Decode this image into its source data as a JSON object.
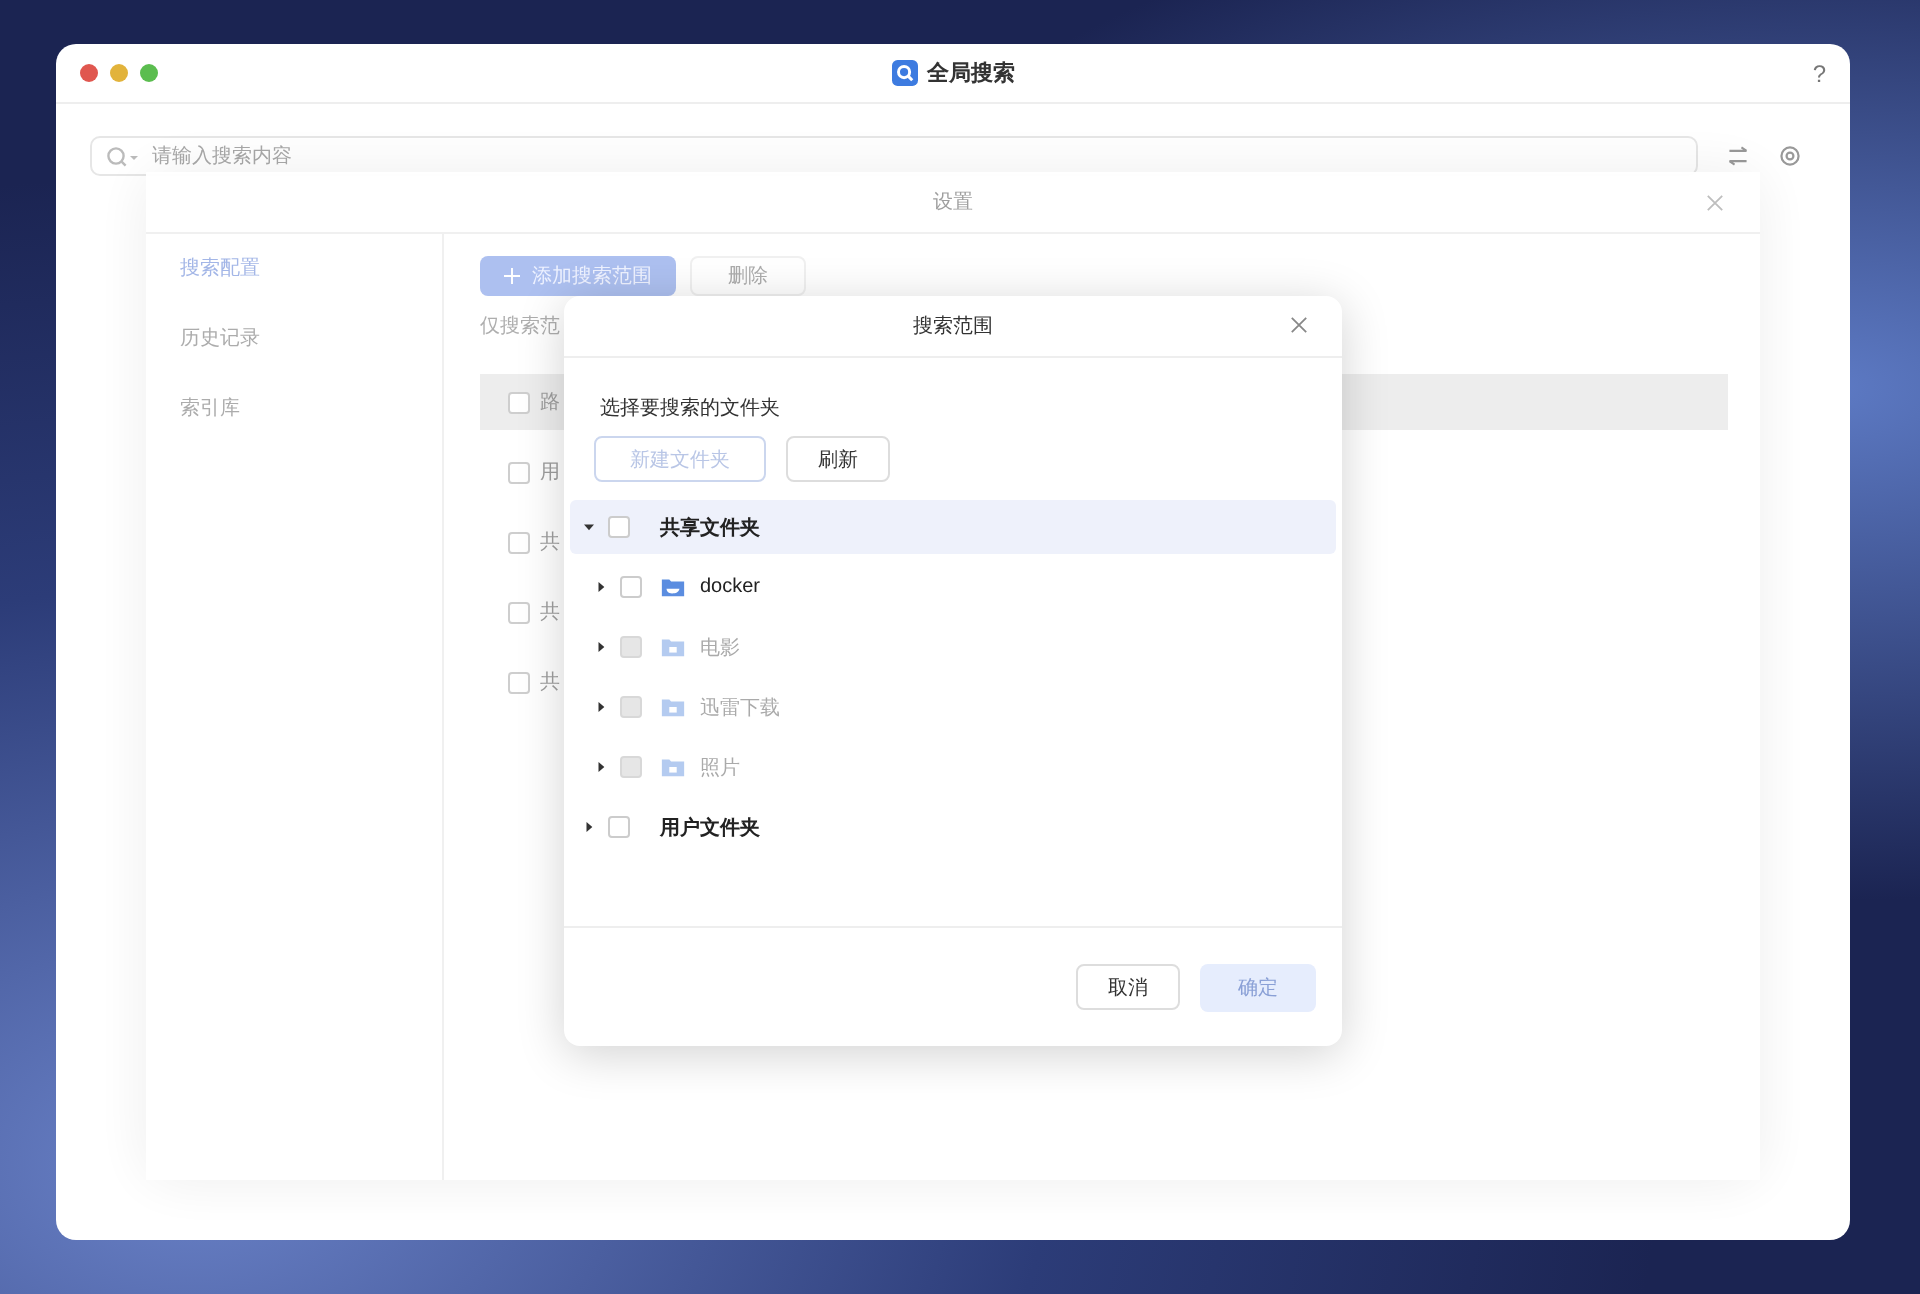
{
  "window": {
    "title": "全局搜索",
    "help": "?"
  },
  "search": {
    "placeholder": "请输入搜索内容"
  },
  "settings": {
    "title": "设置",
    "nav": [
      {
        "label": "搜索配置",
        "selected": true
      },
      {
        "label": "历史记录",
        "selected": false
      },
      {
        "label": "索引库",
        "selected": false
      }
    ],
    "add_button": "添加搜索范围",
    "delete_button": "删除",
    "hint": "仅搜索范",
    "rows": [
      {
        "label": "路",
        "checked": false,
        "selected": true
      },
      {
        "label": "用",
        "checked": false,
        "selected": false
      },
      {
        "label": "共",
        "checked": false,
        "selected": false
      },
      {
        "label": "共",
        "checked": false,
        "selected": false
      },
      {
        "label": "共",
        "checked": false,
        "selected": false
      }
    ]
  },
  "dialog": {
    "title": "搜索范围",
    "instruction": "选择要搜索的文件夹",
    "new_folder": {
      "label": "新建文件夹",
      "disabled": true
    },
    "refresh": "刷新",
    "tree": [
      {
        "label": "共享文件夹",
        "expanded": true,
        "checked": false,
        "selected": true,
        "children": [
          {
            "label": "docker",
            "kind": "docker",
            "checked": false,
            "disabled": false
          },
          {
            "label": "电影",
            "kind": "folder",
            "checked": false,
            "disabled": true
          },
          {
            "label": "迅雷下载",
            "kind": "folder",
            "checked": false,
            "disabled": true
          },
          {
            "label": "照片",
            "kind": "folder",
            "checked": false,
            "disabled": true
          }
        ]
      },
      {
        "label": "用户文件夹",
        "expanded": false,
        "checked": false,
        "selected": false
      }
    ],
    "cancel": "取消",
    "confirm": {
      "label": "确定",
      "disabled": true
    }
  }
}
